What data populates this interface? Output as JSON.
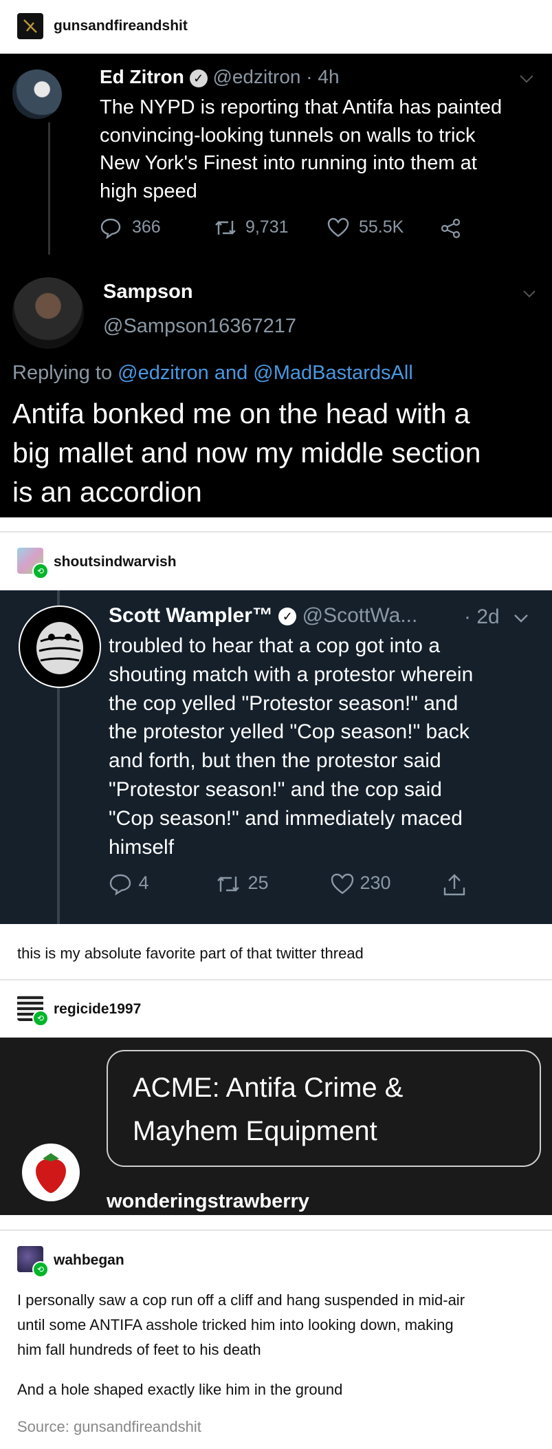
{
  "post1": {
    "username": "gunsandfireandshit",
    "tweet": {
      "name": "Ed Zitron",
      "handle": "@edzitron",
      "time": "· 4h",
      "text_lines": [
        "The NYPD is reporting that Antifa has painted",
        "convincing-looking tunnels on walls to trick",
        "New York's Finest into running into them at",
        "high speed"
      ],
      "replies": "366",
      "retweets": "9,731",
      "likes": "55.5K"
    },
    "reply": {
      "name": "Sampson",
      "handle": "@Sampson16367217",
      "replying_prefix": "Replying to",
      "replying_to": "@edzitron and @MadBastardsAll",
      "text_lines": [
        "Antifa bonked me on the head with a",
        "big mallet and now my middle section",
        "is an accordion"
      ]
    }
  },
  "post2": {
    "username": "shoutsindwarvish",
    "tweet": {
      "name": "Scott Wampler™",
      "handle": "@ScottWa...",
      "time": "· 2d",
      "text_lines": [
        "troubled to hear that a cop got into a",
        "shouting match with a protestor wherein",
        "the cop yelled \"Protestor season!\" and",
        "the protestor yelled \"Cop season!\" back",
        "and forth, but then the protestor said",
        "\"Protestor season!\" and the cop said",
        "\"Cop season!\" and immediately maced",
        "himself"
      ],
      "replies": "4",
      "retweets": "25",
      "likes": "230"
    },
    "comment": "this is my absolute favorite part of that twitter thread"
  },
  "post3": {
    "username": "regicide1997",
    "quote_lines": [
      "ACME: Antifa Crime &",
      "Mayhem Equipment"
    ],
    "quote_author": "wonderingstrawberry"
  },
  "post4": {
    "username": "wahbegan",
    "paragraph1_lines": [
      "I personally saw a cop run off a cliff and hang suspended in mid-air",
      "until some ANTIFA asshole tricked him into looking down, making",
      "him fall hundreds of feet to his death"
    ],
    "paragraph2": "And a hole shaped exactly like him in the ground",
    "source_label": "Source:",
    "source_name": "gunsandfireandshit"
  },
  "colors": {
    "twitter_dark": "#15202b",
    "twitter_link": "#1d9bf0",
    "reblog_green": "#00b52a"
  }
}
